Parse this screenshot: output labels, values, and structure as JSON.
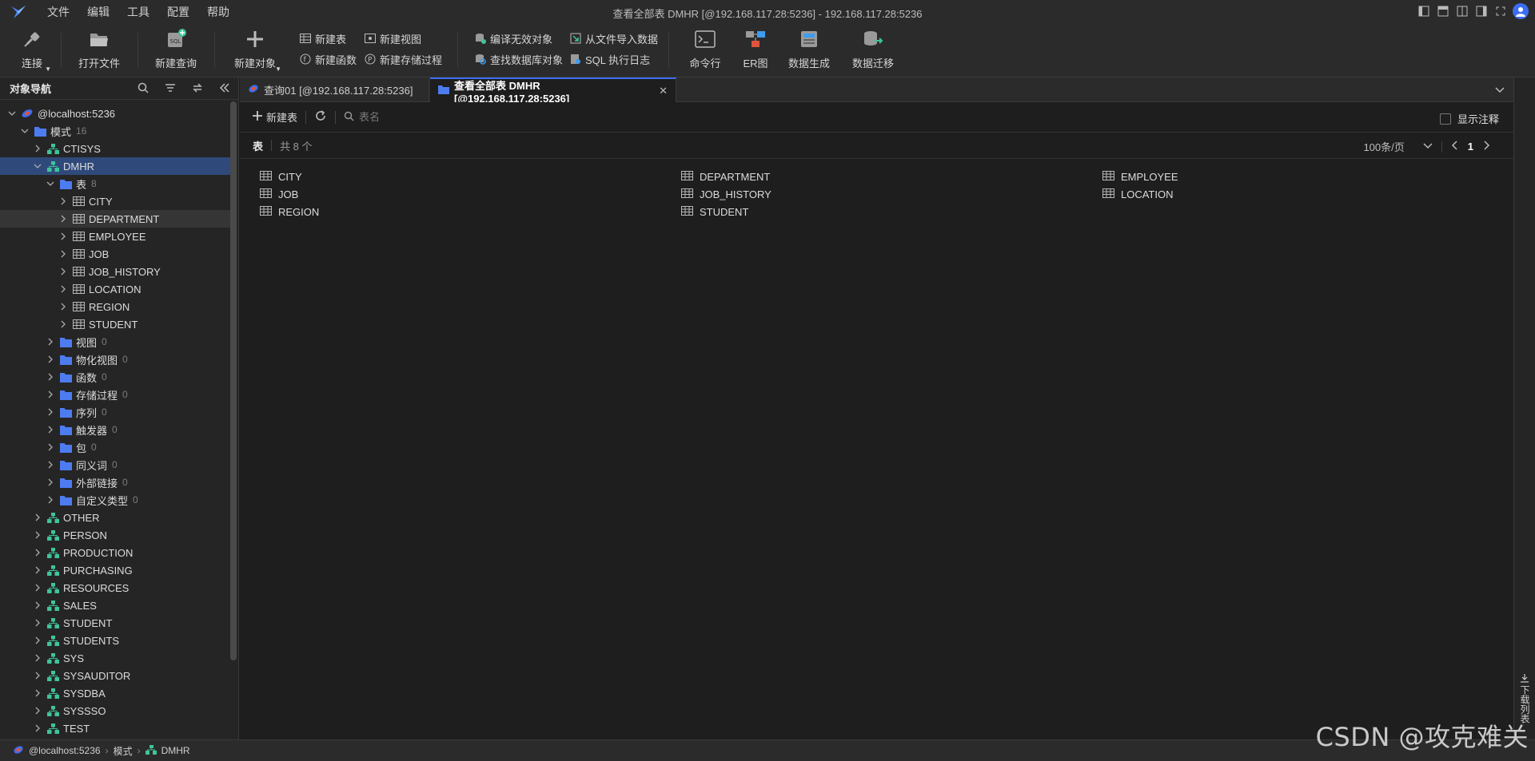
{
  "menu": [
    "文件",
    "编辑",
    "工具",
    "配置",
    "帮助"
  ],
  "window_title": "查看全部表 DMHR [@192.168.117.28:5236]  - 192.168.117.28:5236",
  "toolbar": {
    "connect": "连接",
    "open_file": "打开文件",
    "new_query": "新建查询",
    "new_object": "新建对象",
    "new_table": "新建表",
    "new_view": "新建视图",
    "new_function": "新建函数",
    "new_procedure": "新建存储过程",
    "compile_invalid": "编译无效对象",
    "import_from_file": "从文件导入数据",
    "find_db_object": "查找数据库对象",
    "sql_log": "SQL 执行日志",
    "command_line": "命令行",
    "er_diagram": "ER图",
    "data_generation": "数据生成",
    "data_migration": "数据迁移"
  },
  "nav": {
    "title": "对象导航",
    "tree": [
      {
        "label": "@localhost:5236",
        "icon": "server-icon",
        "level": 0,
        "expanded": true
      },
      {
        "label": "模式",
        "count": "16",
        "icon": "folder-icon",
        "level": 1,
        "expanded": true
      },
      {
        "label": "CTISYS",
        "icon": "schema-icon",
        "level": 2,
        "expanded": false
      },
      {
        "label": "DMHR",
        "icon": "schema-icon",
        "level": 2,
        "expanded": true,
        "selected": true
      },
      {
        "label": "表",
        "count": "8",
        "icon": "folder-icon",
        "level": 3,
        "expanded": true
      },
      {
        "label": "CITY",
        "icon": "table-icon",
        "level": 4,
        "expanded": false
      },
      {
        "label": "DEPARTMENT",
        "icon": "table-icon",
        "level": 4,
        "expanded": false,
        "hover": true
      },
      {
        "label": "EMPLOYEE",
        "icon": "table-icon",
        "level": 4,
        "expanded": false
      },
      {
        "label": "JOB",
        "icon": "table-icon",
        "level": 4,
        "expanded": false
      },
      {
        "label": "JOB_HISTORY",
        "icon": "table-icon",
        "level": 4,
        "expanded": false
      },
      {
        "label": "LOCATION",
        "icon": "table-icon",
        "level": 4,
        "expanded": false
      },
      {
        "label": "REGION",
        "icon": "table-icon",
        "level": 4,
        "expanded": false
      },
      {
        "label": "STUDENT",
        "icon": "table-icon",
        "level": 4,
        "expanded": false
      },
      {
        "label": "视图",
        "count": "0",
        "icon": "folder-icon",
        "level": 3,
        "expanded": false
      },
      {
        "label": "物化视图",
        "count": "0",
        "icon": "folder-icon",
        "level": 3,
        "expanded": false
      },
      {
        "label": "函数",
        "count": "0",
        "icon": "folder-icon",
        "level": 3,
        "expanded": false
      },
      {
        "label": "存储过程",
        "count": "0",
        "icon": "folder-icon",
        "level": 3,
        "expanded": false
      },
      {
        "label": "序列",
        "count": "0",
        "icon": "folder-icon",
        "level": 3,
        "expanded": false
      },
      {
        "label": "触发器",
        "count": "0",
        "icon": "folder-icon",
        "level": 3,
        "expanded": false
      },
      {
        "label": "包",
        "count": "0",
        "icon": "folder-icon",
        "level": 3,
        "expanded": false
      },
      {
        "label": "同义词",
        "count": "0",
        "icon": "folder-icon",
        "level": 3,
        "expanded": false
      },
      {
        "label": "外部链接",
        "count": "0",
        "icon": "folder-icon",
        "level": 3,
        "expanded": false
      },
      {
        "label": "自定义类型",
        "count": "0",
        "icon": "folder-icon",
        "level": 3,
        "expanded": false
      },
      {
        "label": "OTHER",
        "icon": "schema-icon",
        "level": 2,
        "expanded": false
      },
      {
        "label": "PERSON",
        "icon": "schema-icon",
        "level": 2,
        "expanded": false
      },
      {
        "label": "PRODUCTION",
        "icon": "schema-icon",
        "level": 2,
        "expanded": false
      },
      {
        "label": "PURCHASING",
        "icon": "schema-icon",
        "level": 2,
        "expanded": false
      },
      {
        "label": "RESOURCES",
        "icon": "schema-icon",
        "level": 2,
        "expanded": false
      },
      {
        "label": "SALES",
        "icon": "schema-icon",
        "level": 2,
        "expanded": false
      },
      {
        "label": "STUDENT",
        "icon": "schema-icon",
        "level": 2,
        "expanded": false
      },
      {
        "label": "STUDENTS",
        "icon": "schema-icon",
        "level": 2,
        "expanded": false
      },
      {
        "label": "SYS",
        "icon": "schema-icon",
        "level": 2,
        "expanded": false
      },
      {
        "label": "SYSAUDITOR",
        "icon": "schema-icon",
        "level": 2,
        "expanded": false
      },
      {
        "label": "SYSDBA",
        "icon": "schema-icon",
        "level": 2,
        "expanded": false
      },
      {
        "label": "SYSSSO",
        "icon": "schema-icon",
        "level": 2,
        "expanded": false
      },
      {
        "label": "TEST",
        "icon": "schema-icon",
        "level": 2,
        "expanded": false
      }
    ]
  },
  "tabs": [
    {
      "label": "查询01 [@192.168.117.28:5236]",
      "icon": "query-icon",
      "active": false
    },
    {
      "label": "查看全部表 DMHR [@192.168.117.28:5236]",
      "icon": "folder-icon",
      "active": true
    }
  ],
  "content": {
    "new_table": "新建表",
    "search_placeholder": "表名",
    "show_comment": "显示注释",
    "section_title": "表",
    "count_text": "共 8 个",
    "page_size": "100条/页",
    "page_number": "1",
    "tables": [
      "CITY",
      "DEPARTMENT",
      "EMPLOYEE",
      "JOB",
      "JOB_HISTORY",
      "LOCATION",
      "REGION",
      "STUDENT"
    ]
  },
  "right_strip": {
    "label": "下载列表"
  },
  "status": {
    "server": "@localhost:5236",
    "schema_folder": "模式",
    "schema": "DMHR"
  },
  "watermark": "CSDN @攻克难关",
  "colors": {
    "accent": "#3d6df0",
    "schema_green": "#3fc49a",
    "folder_blue": "#4d7cf0"
  }
}
